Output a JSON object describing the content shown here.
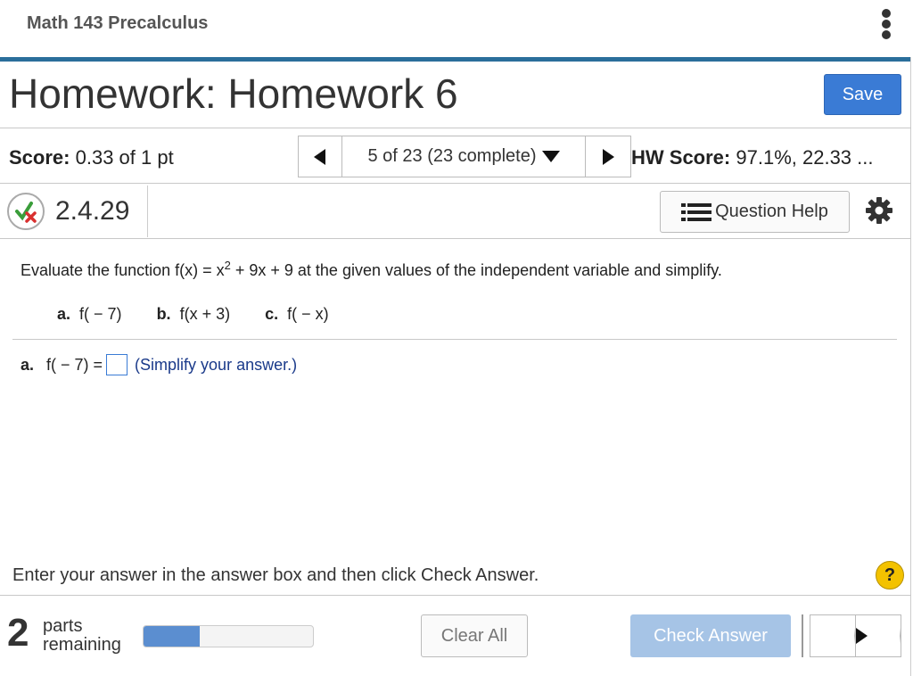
{
  "header": {
    "course": "Math 143 Precalculus",
    "menu_icon": "kebab-menu-icon"
  },
  "title_bar": {
    "title": "Homework: Homework 6",
    "save_label": "Save",
    "save_color": "#3a7bd5"
  },
  "score_bar": {
    "score_label": "Score:",
    "score_value": "0.33 of 1 pt",
    "question_nav": "5 of 23 (23 complete)",
    "hw_score_label": "HW Score:",
    "hw_score_value": "97.1%, 22.33 ..."
  },
  "question_header": {
    "status_icon": "partially-correct-icon",
    "number": "2.4.29",
    "help_label": "Question Help"
  },
  "question": {
    "prompt_pre": "Evaluate the function f(x) = x",
    "prompt_sup": "2",
    "prompt_post": " + 9x + 9 at the given values of the independent variable and simplify.",
    "parts": [
      {
        "letter": "a.",
        "expr": "f( − 7)"
      },
      {
        "letter": "b.",
        "expr": "f(x + 3)"
      },
      {
        "letter": "c.",
        "expr": "f( − x)"
      }
    ],
    "answer_letter": "a.",
    "answer_expr": "f( − 7) =",
    "answer_value": "",
    "answer_hint": "(Simplify your answer.)"
  },
  "footer": {
    "instruction": "Enter your answer in the answer box and then click Check Answer.",
    "help_glyph": "?",
    "parts_count": "2",
    "parts_label_1": "parts",
    "parts_label_2": "remaining",
    "progress_fraction": 0.33,
    "clear_label": "Clear All",
    "check_label": "Check Answer"
  }
}
